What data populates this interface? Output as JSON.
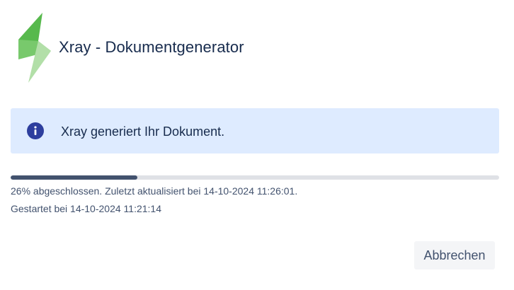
{
  "header": {
    "title": "Xray - Dokumentgenerator",
    "logo_icon": "xray-lightning-icon"
  },
  "banner": {
    "icon": "info-icon",
    "message": "Xray generiert Ihr Dokument."
  },
  "progress": {
    "percent": 26,
    "status_text": "26% abgeschlossen. Zuletzt aktualisiert bei 14-10-2024 11:26:01.",
    "started_text": "Gestartet bei 14-10-2024 11:21:14"
  },
  "actions": {
    "cancel_label": "Abbrechen"
  },
  "colors": {
    "banner_bg": "#deebff",
    "info_icon": "#2d3e9e",
    "progress_fill": "#42526e",
    "progress_track": "#dfe1e6",
    "logo_dark": "#57b94d",
    "logo_mid": "#7ccd6f",
    "logo_light": "#b2dfa8"
  }
}
